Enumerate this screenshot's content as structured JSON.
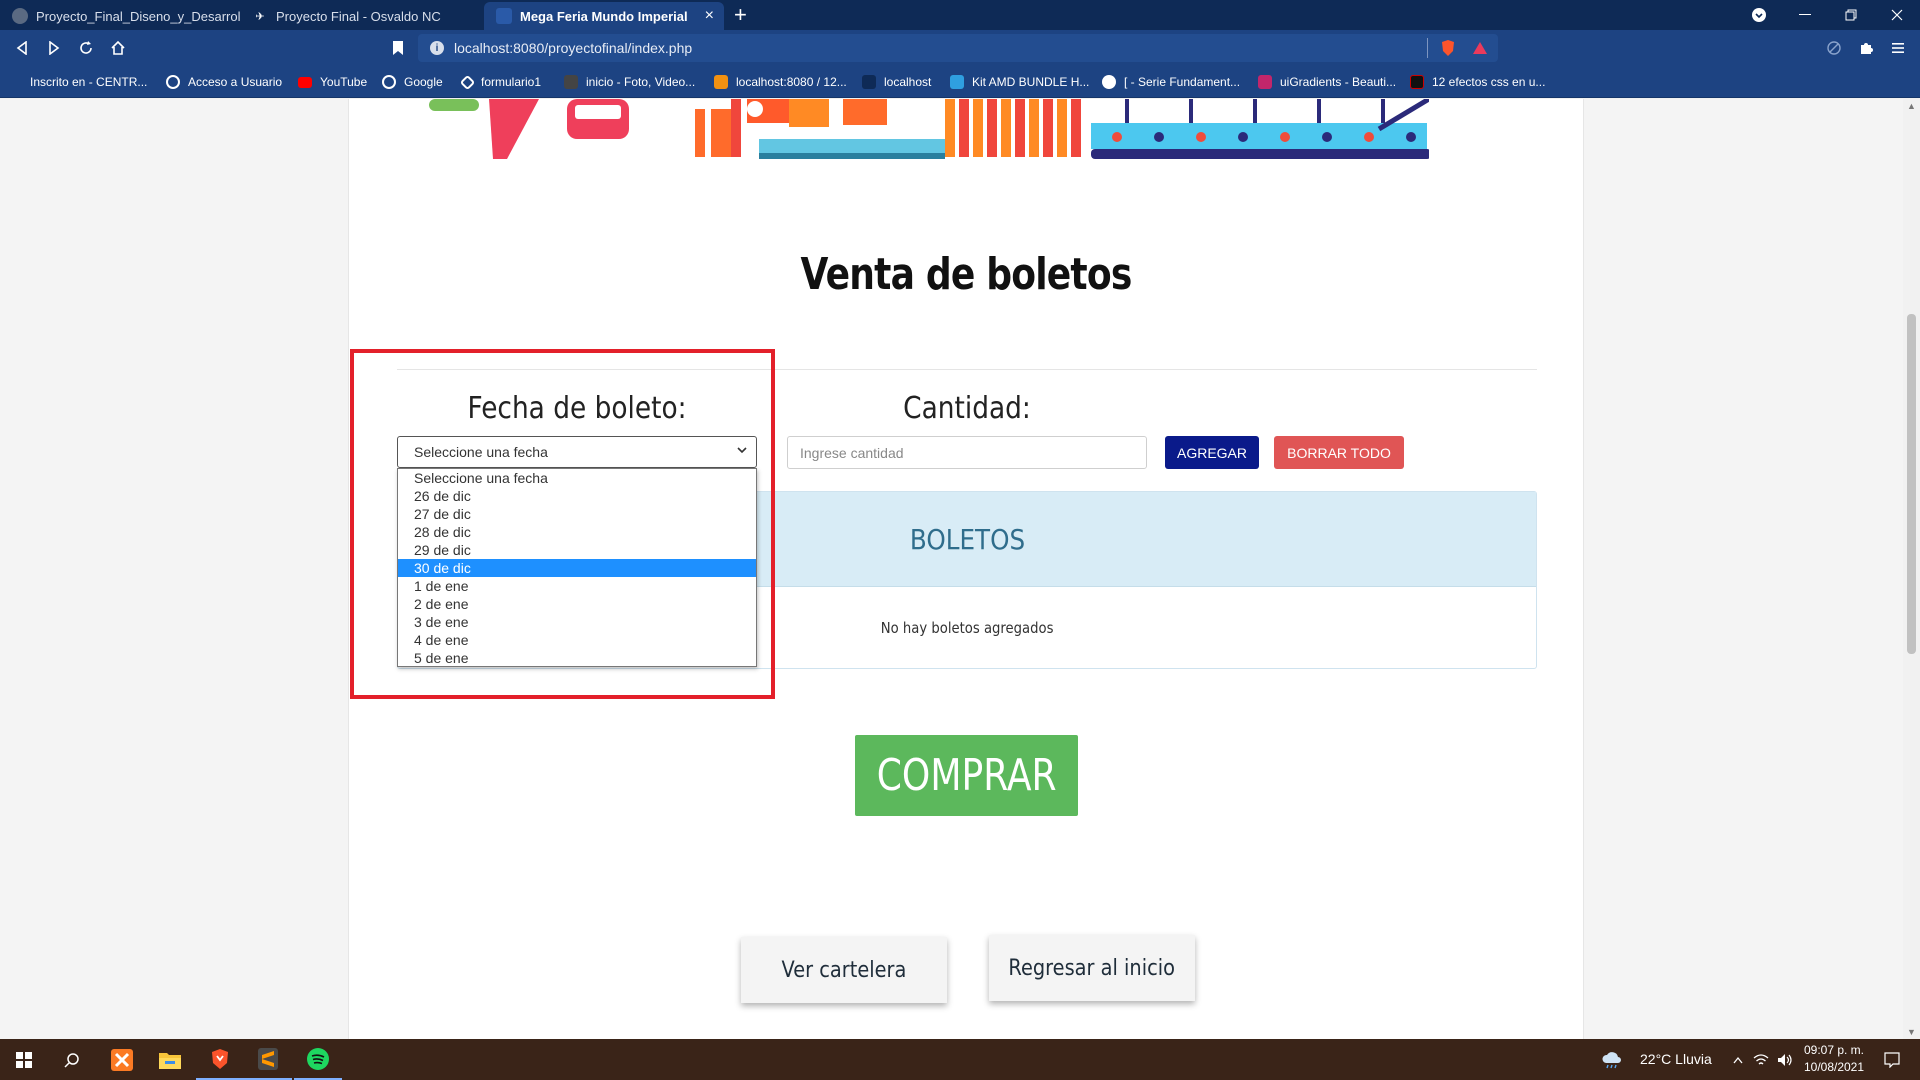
{
  "browser": {
    "tabs": [
      {
        "label": "Proyecto_Final_Diseno_y_Desarrollo_C",
        "active": false
      },
      {
        "label": "Proyecto Final - Osvaldo NC",
        "active": false
      },
      {
        "label": "Mega Feria Mundo Imperial",
        "active": true
      }
    ],
    "new_tab": "+",
    "close_tab": "×",
    "url": "localhost:8080/proyectofinal/index.php",
    "bookmarks": [
      {
        "label": "Inscrito en - CENTR...",
        "color": "#ffffff"
      },
      {
        "label": "Acceso a Usuario",
        "color": "#ffffff"
      },
      {
        "label": "YouTube",
        "color": "#ff0000"
      },
      {
        "label": "Google",
        "color": "#ffffff"
      },
      {
        "label": "formulario1",
        "color": "#ffffff"
      },
      {
        "label": "inicio - Foto, Video...",
        "color": "#444444"
      },
      {
        "label": "localhost:8080 / 12...",
        "color": "#f29111"
      },
      {
        "label": "localhost",
        "color": "#0e2a56"
      },
      {
        "label": "Kit AMD BUNDLE H...",
        "color": "#2f9fe0"
      },
      {
        "label": "[ - Serie Fundament...",
        "color": "#ffffff"
      },
      {
        "label": "uiGradients - Beauti...",
        "color": "#c2266b"
      },
      {
        "label": "12 efectos css en u...",
        "color": "#111111"
      }
    ]
  },
  "page": {
    "title": "Venta de boletos",
    "date_label": "Fecha de boleto:",
    "qty_label": "Cantidad:",
    "select_value": "Seleccione una fecha",
    "date_options": [
      "Seleccione una fecha",
      "26 de dic",
      "27 de dic",
      "28 de dic",
      "29 de dic",
      "30 de dic",
      "1 de ene",
      "2 de ene",
      "3 de ene",
      "4 de ene",
      "5 de ene"
    ],
    "highlighted_option": "30 de dic",
    "qty_placeholder": "Ingrese cantidad",
    "add_button": "AGREGAR",
    "clear_button": "BORRAR TODO",
    "tickets_header": "BOLETOS",
    "tickets_empty": "No hay boletos agregados",
    "buy_button": "COMPRAR",
    "billboard_button": "Ver cartelera",
    "home_button": "Regresar al inicio"
  },
  "taskbar": {
    "weather": "22°C  Lluvia",
    "time": "09:07 p. m.",
    "date": "10/08/2021"
  },
  "colors": {
    "browser_frame": "#1d4382",
    "add_button": "#0a1a8a",
    "clear_button": "#e05555",
    "buy_button": "#5cb85c",
    "highlight_border": "#e3202a",
    "tickets_header_bg": "#d8ecf6"
  }
}
